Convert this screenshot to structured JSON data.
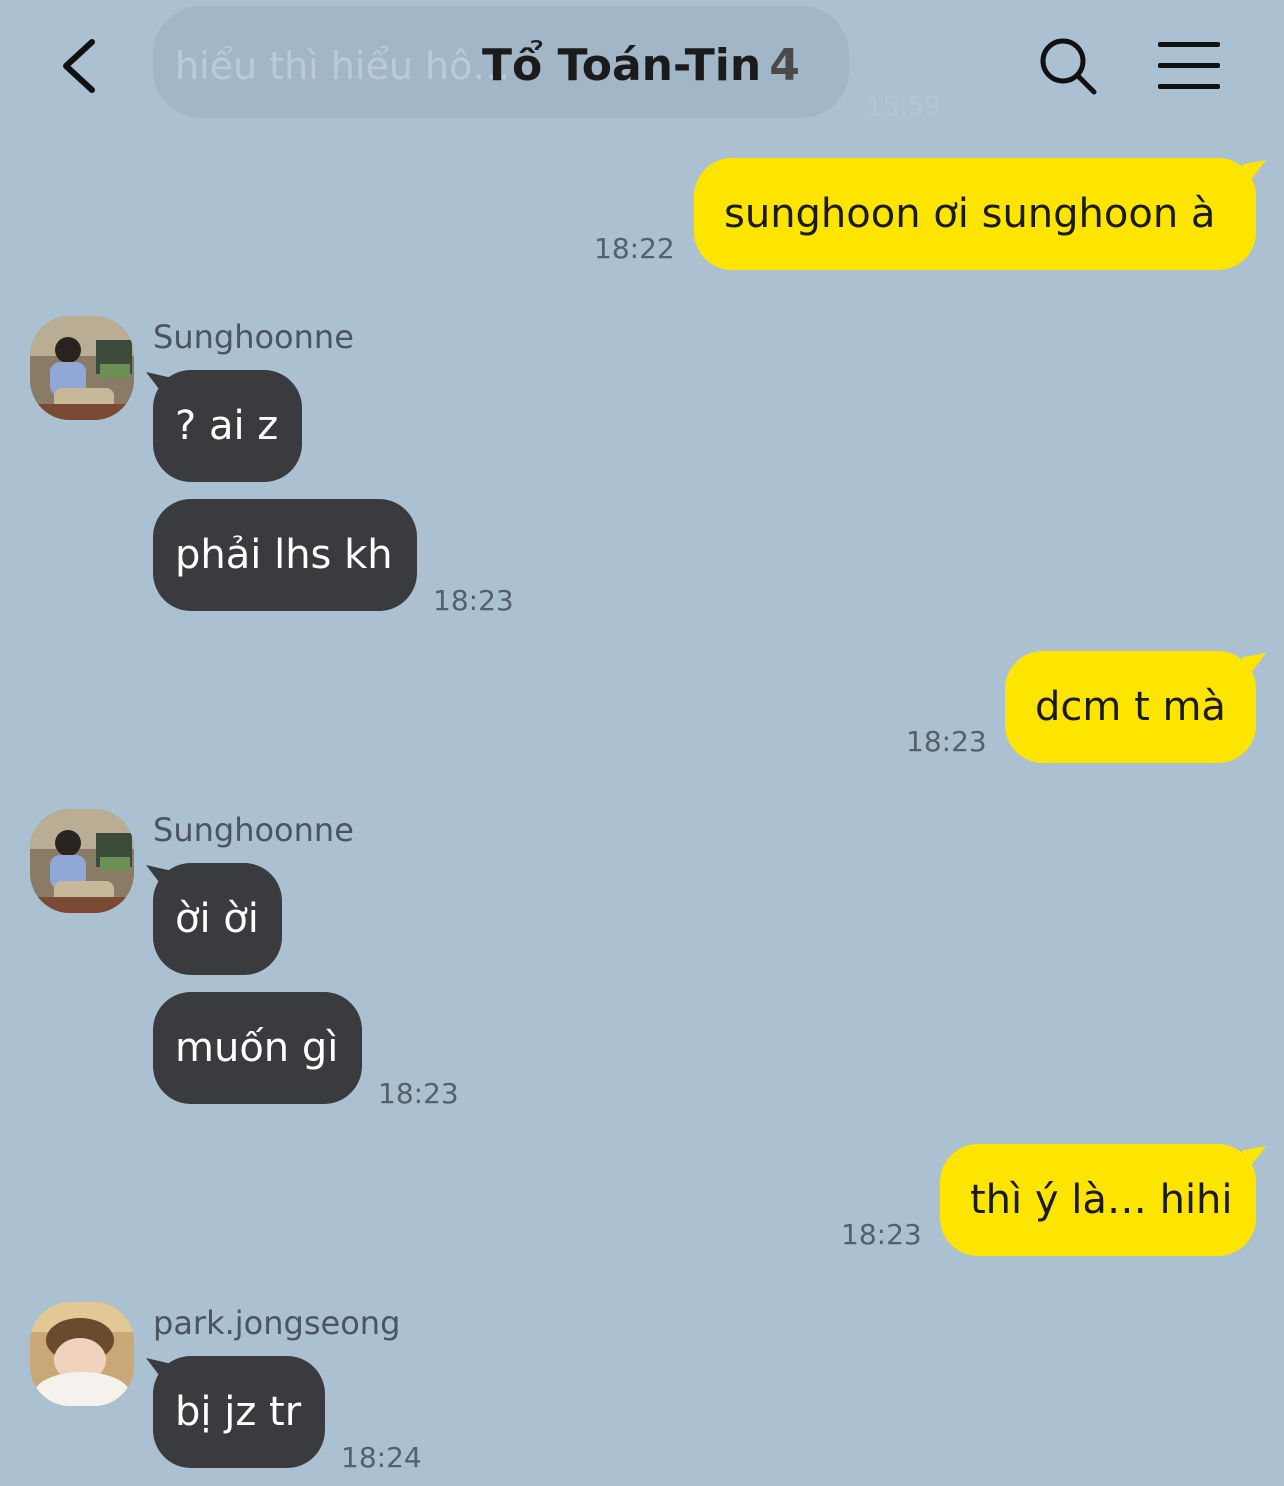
{
  "header": {
    "title": "Tổ Toán-Tin",
    "member_count": "4",
    "ghost_message": "hiểu thì hiểu hô…",
    "ghost_time": "15:59"
  },
  "messages": [
    {
      "side": "out",
      "text": "sunghoon ơi sunghoon à",
      "time": "18:22"
    },
    {
      "side": "in",
      "sender": "Sunghoonne",
      "texts": [
        "? ai z",
        "phải lhs kh"
      ],
      "time": "18:23"
    },
    {
      "side": "out",
      "text": "dcm t mà",
      "time": "18:23"
    },
    {
      "side": "in",
      "sender": "Sunghoonne",
      "texts": [
        "ời ời",
        "muốn gì"
      ],
      "time": "18:23"
    },
    {
      "side": "out",
      "text": "thì ý là… hihi",
      "time": "18:23"
    },
    {
      "side": "in",
      "sender": "park.jongseong",
      "texts": [
        "bị jz tr"
      ],
      "time": "18:24"
    }
  ],
  "colors": {
    "background": "#abc1d2",
    "outgoing_bubble": "#fee500",
    "incoming_bubble": "#3a3b3e"
  },
  "icons": [
    "back-chevron-icon",
    "search-icon",
    "menu-icon"
  ]
}
